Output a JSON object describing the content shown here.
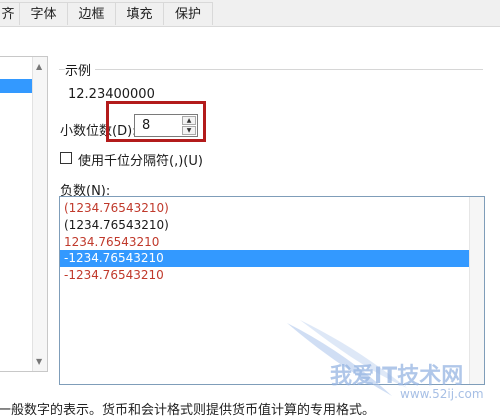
{
  "tabs": [
    "齐",
    "字体",
    "边框",
    "填充",
    "保护"
  ],
  "sample": {
    "label": "示例",
    "value": "12.23400000"
  },
  "decimal_places": {
    "label": "小数位数(D):",
    "value": "8"
  },
  "thousands_separator": {
    "label": "使用千位分隔符(,)(U)",
    "checked": false
  },
  "negative_numbers": {
    "label": "负数(N):",
    "items": [
      {
        "text": "(1234.76543210)",
        "color": "red"
      },
      {
        "text": "(1234.76543210)",
        "color": "black"
      },
      {
        "text": "1234.76543210",
        "color": "red"
      },
      {
        "text": "-1234.76543210",
        "color": "black",
        "selected": true
      },
      {
        "text": "-1234.76543210",
        "color": "red"
      }
    ]
  },
  "description": "一般数字的表示。货币和会计格式则提供货币值计算的专用格式。",
  "watermark": {
    "text": "我爱IT技术网",
    "url": "www.52ij.com"
  },
  "colors": {
    "highlight": "#b31b1b",
    "selection": "#3399ff",
    "negative_red": "#c0392b"
  }
}
